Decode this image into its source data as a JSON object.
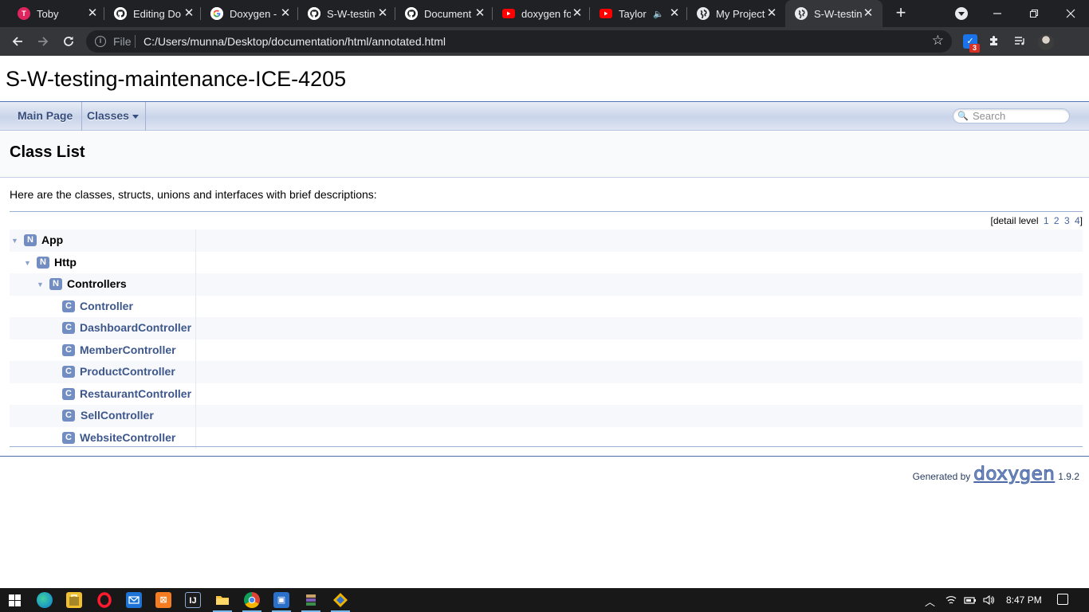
{
  "browser": {
    "tabs": [
      {
        "title": "Toby",
        "favicon": "trello-icon",
        "active": false
      },
      {
        "title": "Editing Do",
        "favicon": "github-icon",
        "active": false
      },
      {
        "title": "Doxygen -",
        "favicon": "google-icon",
        "active": false
      },
      {
        "title": "S-W-testin",
        "favicon": "github-icon",
        "active": false
      },
      {
        "title": "Document",
        "favicon": "github-icon",
        "active": false
      },
      {
        "title": "doxygen fo",
        "favicon": "youtube-icon",
        "active": false
      },
      {
        "title": "Taylor",
        "favicon": "youtube-icon",
        "active": false,
        "audio": true
      },
      {
        "title": "My Project",
        "favicon": "globe-icon",
        "active": false
      },
      {
        "title": "S-W-testin",
        "favicon": "globe-icon",
        "active": true
      }
    ],
    "close_glyph": "✕",
    "new_tab_glyph": "+",
    "audio_glyph": "🔈",
    "omnibox": {
      "scheme_label": "File",
      "url": "C:/Users/munna/Desktop/documentation/html/annotated.html"
    },
    "extension_badge": "3"
  },
  "doc": {
    "project_title": "S-W-testing-maintenance-ICE-4205",
    "nav": {
      "main_page": "Main Page",
      "classes": "Classes"
    },
    "search_placeholder": "Search",
    "page_title": "Class List",
    "intro": "Here are the classes, structs, unions and interfaces with brief descriptions:",
    "detail_level": {
      "prefix": "[detail level",
      "levels": [
        "1",
        "2",
        "3",
        "4"
      ],
      "suffix": "]"
    },
    "namespace_icon_letter": "N",
    "class_icon_letter": "C",
    "tree": [
      {
        "kind": "namespace",
        "name": "App",
        "depth": 0,
        "expanded": true
      },
      {
        "kind": "namespace",
        "name": "Http",
        "depth": 1,
        "expanded": true
      },
      {
        "kind": "namespace",
        "name": "Controllers",
        "depth": 2,
        "expanded": true
      },
      {
        "kind": "class",
        "name": "Controller",
        "depth": 3
      },
      {
        "kind": "class",
        "name": "DashboardController",
        "depth": 3
      },
      {
        "kind": "class",
        "name": "MemberController",
        "depth": 3
      },
      {
        "kind": "class",
        "name": "ProductController",
        "depth": 3
      },
      {
        "kind": "class",
        "name": "RestaurantController",
        "depth": 3
      },
      {
        "kind": "class",
        "name": "SellController",
        "depth": 3
      },
      {
        "kind": "class",
        "name": "WebsiteController",
        "depth": 3
      }
    ],
    "footer": {
      "generated_by": "Generated by",
      "logo_text": "doxygen",
      "version": "1.9.2"
    }
  },
  "taskbar": {
    "clock": "8:47 PM"
  },
  "colors": {
    "link": "#3d578c",
    "nav_text": "#364d7c",
    "icon_bg": "#728dc1",
    "chrome_dark": "#202124",
    "chrome_toolbar": "#35363a"
  }
}
